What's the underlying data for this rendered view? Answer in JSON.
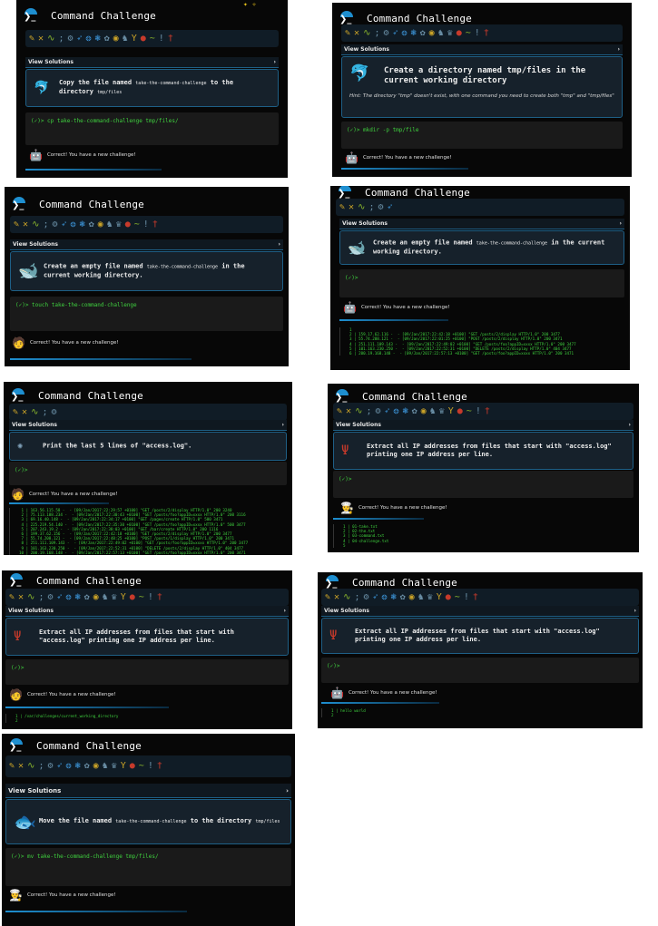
{
  "app": {
    "title": "Command Challenge",
    "logo_glyph": "❯_"
  },
  "common": {
    "view_solutions": "View Solutions",
    "chevron": "›",
    "correct": "Correct! You have a new challenge!",
    "prompt": "(✓)>"
  },
  "p1": {
    "challenge_main": "Copy the file named ",
    "challenge_mono1": "take-the-command-challenge",
    "challenge_mid": " to the directory ",
    "challenge_mono2": "tmp/files",
    "command": "(✓)> cp take-the-command-challenge tmp/files/"
  },
  "p2": {
    "challenge": "Create a directory named tmp/files in the current working directory",
    "hint": "Hint: The directory \"tmp\" doesn't exist, with one command you need to create both \"tmp\" and \"tmp/files\"",
    "command": "(✓)> mkdir -p tmp/file"
  },
  "p3": {
    "challenge_main": "Create an empty file named ",
    "challenge_mono": "take-the-command-challenge",
    "challenge_tail": " in the current working directory.",
    "command": "(✓)> touch take-the-command-challenge"
  },
  "p4": {
    "challenge_main": "Create an empty file named ",
    "challenge_mono": "take-the-command-challenge",
    "challenge_tail": " in the current working directory.",
    "command": "(✓)>",
    "output": "1\n2 | 159.17.62.116 -  - [09/Jan/2017:22:42:18 +0100] \"GET /posts/2/display HTTP/1.0\" 200 3477\n3 | 55.74.288.121 -  - [09/Jan/2017:22:01:25 +0100] \"POST /posts/2/display HTTP/1.0\" 200 3471\n4 | 251.111.109.143 -  - [09/Jan/2017:22:49:02 +0100] \"GET /posts/foo?appID=xxxx HTTP/1.0\" 200 3477\n5 | 101.163.230.250 -  - [09/Jan/2017:22:52:31 +0100] \"DELETE /posts/2/display HTTP/1.0\" 404 3477\n6 | 200.19.168.148 -  - [09/Jan/2017:22:57:13 +0100] \"GET /posts/foo?appID=xxxx HTTP/1.0\" 200 3471"
  },
  "p5": {
    "challenge": "Print the last 5 lines of \"access.log\".",
    "command": "(✓)>",
    "output": " 1 | 163.56.115.58 -  - [09/Jan/2017:22:29:57 +0100] \"GET /posts/2/display HTTP/1.0\" 200 3240\n 2 | 75.113.188.234 -  - [09/Jan/2017:22:30:43 +0100] \"GET /posts/foo?appID=xxxx HTTP/1.0\" 200 3116\n 3 | 69.16.40.148 -  - [09/Jan/2017:22:34:17 +0100] \"GET /pages/create HTTP/1.0\" 500 3471\n 4 | 225.219.54.140 -  - [09/Jan/2017:22:35:30 +0100] \"GET /posts/foo?appID=xxxx HTTP/1.0\" 500 3477\n 5 | 207.243.19.2 -  - [09/Jan/2017:22:38:03 +0100] \"GET /bar/create HTTP/1.0\" 200 1116\n 6 | 199.37.62.156 -  - [09/Jan/2017:22:42:18 +0100] \"GET /posts/2/display HTTP/1.0\" 200 3477\n 7 | 55.74.208.121 -  - [09/Jan/2017:22:48:25 +0100] \"POST /posts/1/display HTTP/1.0\" 200 3471\n 8 | 251.111.109.143 -  - [09/Jan/2017:22:49:02 +0100] \"GET /posts/foo?appID=xxxx HTTP/1.0\" 200 3477\n 9 | 101.163.230.250 -  - [09/Jan/2017:22:52:31 +0100] \"DELETE /posts/2/display HTTP/1.0\" 404 3477\n10 | 200.19.168.148 -  - [09/Jan/2017:22:57:13 +0100] \"GET /posts/foo?appID=xxxx HTTP/1.0\" 200 3471\n11"
  },
  "p6": {
    "challenge": "Extract all IP addresses from files that start with \"access.log\" printing one IP address per line.",
    "command": "(✓)>",
    "output": "1 | 01-take.txt\n2 | 02-the.txt\n3 | 03-command.txt\n4 | 04-challenge.txt\n5"
  },
  "p7": {
    "challenge": "Extract all IP addresses from files that start with \"access.log\" printing one IP address per line.",
    "command": "(✓)>",
    "output": "1 | /var/challenges/current_working_directory\n2"
  },
  "p8": {
    "challenge": "Extract all IP addresses from files that start with \"access.log\" printing one IP address per line.",
    "command": "(✓)>",
    "output": "1 | hello world\n2"
  },
  "p9": {
    "challenge_main": "Move the file named ",
    "challenge_mono1": "take-the-command-challenge",
    "challenge_mid": " to the directory ",
    "challenge_mono2": "tmp/files",
    "command": "(✓)> mv take-the-command-challenge tmp/files/"
  }
}
